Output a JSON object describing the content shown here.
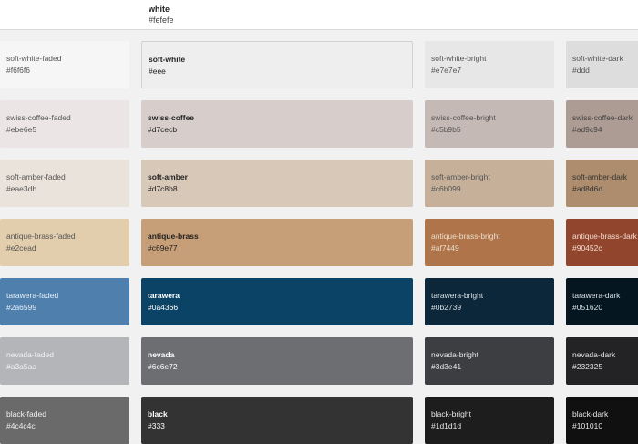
{
  "top": {
    "name": "white",
    "hex": "#fefefe"
  },
  "rows": [
    {
      "faded": {
        "name": "soft-white-faded",
        "hex": "#f6f6f6",
        "color": "#f6f6f6",
        "text": "#555555"
      },
      "base": {
        "name": "soft-white",
        "hex": "#eee",
        "color": "#eeeeee",
        "text": "#222222"
      },
      "bright": {
        "name": "soft-white-bright",
        "hex": "#e7e7e7",
        "color": "#e7e7e7",
        "text": "#555555"
      },
      "dark": {
        "name": "soft-white-dark",
        "hex": "#ddd",
        "color": "#dddddd",
        "text": "#555555"
      }
    },
    {
      "faded": {
        "name": "swiss-coffee-faded",
        "hex": "#ebe6e5",
        "color": "#ebe6e5",
        "text": "#555555"
      },
      "base": {
        "name": "swiss-coffee",
        "hex": "#d7cecb",
        "color": "#d7cecb",
        "text": "#222222"
      },
      "bright": {
        "name": "swiss-coffee-bright",
        "hex": "#c5b9b5",
        "color": "#c5b9b5",
        "text": "#555555"
      },
      "dark": {
        "name": "swiss-coffee-dark",
        "hex": "#ad9c94",
        "color": "#ad9c94",
        "text": "#444444"
      }
    },
    {
      "faded": {
        "name": "soft-amber-faded",
        "hex": "#eae3db",
        "color": "#eae3db",
        "text": "#555555"
      },
      "base": {
        "name": "soft-amber",
        "hex": "#d7c8b8",
        "color": "#d7c8b8",
        "text": "#222222"
      },
      "bright": {
        "name": "soft-amber-bright",
        "hex": "#c6b099",
        "color": "#c6b099",
        "text": "#555555"
      },
      "dark": {
        "name": "soft-amber-dark",
        "hex": "#ad8d6d",
        "color": "#ad8d6d",
        "text": "#333333"
      }
    },
    {
      "faded": {
        "name": "antique-brass-faded",
        "hex": "#e2cead",
        "color": "#e2cead",
        "text": "#555555"
      },
      "base": {
        "name": "antique-brass",
        "hex": "#c69e77",
        "color": "#c69e77",
        "text": "#222222"
      },
      "bright": {
        "name": "antique-brass-bright",
        "hex": "#af7449",
        "color": "#af7449",
        "text": "#eadccc"
      },
      "dark": {
        "name": "antique-brass-dark",
        "hex": "#90452c",
        "color": "#90452c",
        "text": "#f2dcd0"
      }
    },
    {
      "faded": {
        "name": "tarawera-faded",
        "hex": "#2a6599",
        "color": "#4f80ad",
        "text": "#e6eef6"
      },
      "base": {
        "name": "tarawera",
        "hex": "#0a4366",
        "color": "#0a4366",
        "text": "#ffffff"
      },
      "bright": {
        "name": "tarawera-bright",
        "hex": "#0b2739",
        "color": "#0b2739",
        "text": "#d8e0e6"
      },
      "dark": {
        "name": "tarawera-dark",
        "hex": "#051620",
        "color": "#051620",
        "text": "#d8e0e6"
      }
    },
    {
      "faded": {
        "name": "nevada-faded",
        "hex": "#a3a5aa",
        "color": "#b3b5b9",
        "text": "#f3f3f3"
      },
      "base": {
        "name": "nevada",
        "hex": "#6c6e72",
        "color": "#6c6e72",
        "text": "#ffffff"
      },
      "bright": {
        "name": "nevada-bright",
        "hex": "#3d3e41",
        "color": "#3d3e41",
        "text": "#e6e6e6"
      },
      "dark": {
        "name": "nevada-dark",
        "hex": "#232325",
        "color": "#232325",
        "text": "#e6e6e6"
      }
    },
    {
      "faded": {
        "name": "black-faded",
        "hex": "#4c4c4c",
        "color": "#6a6a6a",
        "text": "#eeeeee"
      },
      "base": {
        "name": "black",
        "hex": "#333",
        "color": "#333333",
        "text": "#ffffff"
      },
      "bright": {
        "name": "black-bright",
        "hex": "#1d1d1d",
        "color": "#1d1d1d",
        "text": "#e6e6e6"
      },
      "dark": {
        "name": "black-dark",
        "hex": "#101010",
        "color": "#101010",
        "text": "#e6e6e6"
      }
    }
  ]
}
